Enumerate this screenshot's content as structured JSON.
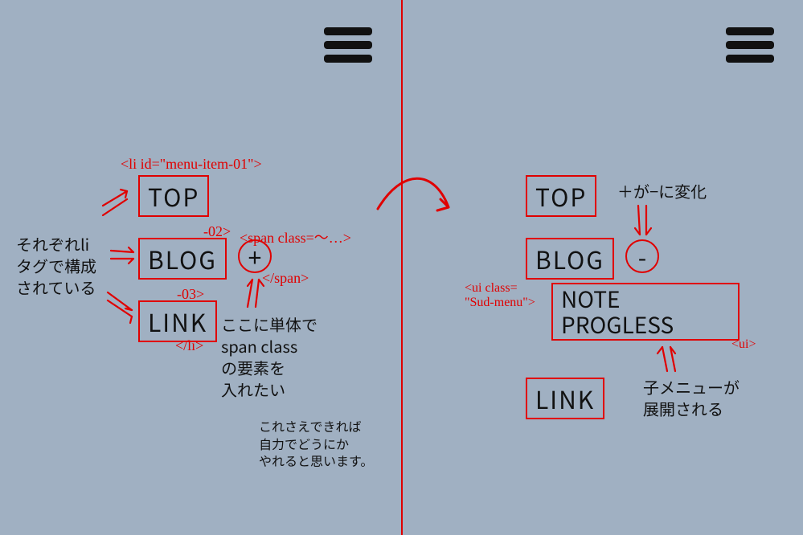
{
  "left": {
    "menu": {
      "top": "TOP",
      "blog": "BLOG",
      "link": "LINK",
      "expand_symbol": "+"
    },
    "code": {
      "li_open": "<li id=\"menu-item-01\">",
      "id02": "-02>",
      "id03": "-03>",
      "span_open": "<span class=〜…>",
      "span_close": "</span>",
      "li_close": "</li>"
    },
    "notes": {
      "li_note": "それぞれli\nタグで構成\nされている",
      "span_note": "ここに単体で\nspan class\nの要素を\n入れたい",
      "footnote": "これさえできれば\n自力でどうにか\nやれると思います。"
    }
  },
  "right": {
    "menu": {
      "top": "TOP",
      "blog": "BLOG",
      "link": "LINK",
      "sub1": "NOTE",
      "sub2": "PROGLESS",
      "expand_symbol": "-"
    },
    "code": {
      "ul_open": "<ui class=\n\"Sud-menu\">",
      "ul_close": "<ui>"
    },
    "notes": {
      "sign_note": "＋が−に変化",
      "sub_note": "子メニューが\n展開される"
    }
  }
}
